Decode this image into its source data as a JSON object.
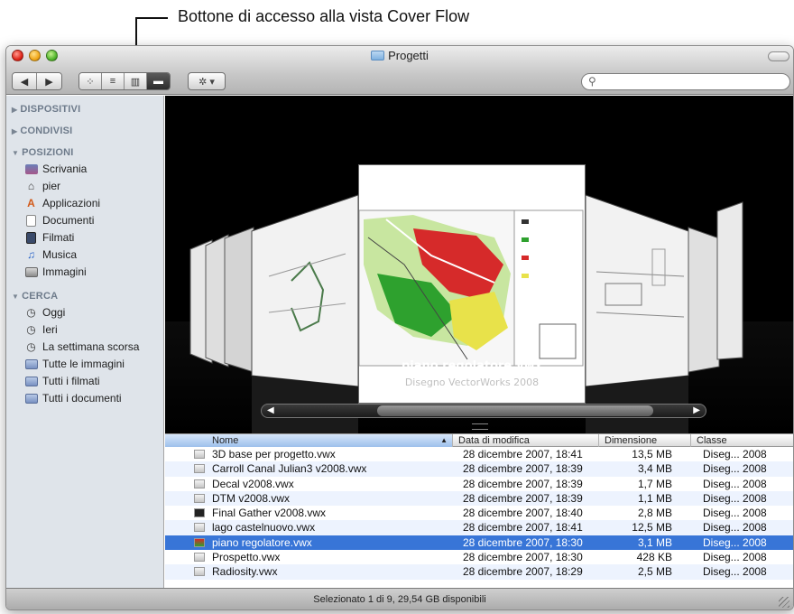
{
  "callout": {
    "text": "Bottone di accesso alla vista Cover Flow"
  },
  "window": {
    "title": "Progetti"
  },
  "toolbar": {
    "back": "◀",
    "forward": "▶",
    "view_icon": "⁘",
    "view_list": "≡",
    "view_columns": "▥",
    "view_coverflow": "▬",
    "action": "✲ ▾",
    "search_icon": "⚲",
    "search_placeholder": ""
  },
  "sidebar": {
    "sections": {
      "devices": "DISPOSITIVI",
      "shared": "CONDIVISI",
      "places": "POSIZIONI",
      "search": "CERCA"
    },
    "places": [
      {
        "label": "Scrivania",
        "icon": "desktop-icon"
      },
      {
        "label": "pier",
        "icon": "home-icon"
      },
      {
        "label": "Applicazioni",
        "icon": "applications-icon"
      },
      {
        "label": "Documenti",
        "icon": "documents-icon"
      },
      {
        "label": "Filmati",
        "icon": "movies-icon"
      },
      {
        "label": "Musica",
        "icon": "music-icon"
      },
      {
        "label": "Immagini",
        "icon": "pictures-icon"
      }
    ],
    "search_items": [
      {
        "label": "Oggi",
        "icon": "clock-icon"
      },
      {
        "label": "Ieri",
        "icon": "clock-icon"
      },
      {
        "label": "La settimana scorsa",
        "icon": "clock-icon"
      },
      {
        "label": "Tutte le immagini",
        "icon": "smart-folder-icon"
      },
      {
        "label": "Tutti i filmati",
        "icon": "smart-folder-icon"
      },
      {
        "label": "Tutti i documenti",
        "icon": "smart-folder-icon"
      }
    ]
  },
  "coverflow": {
    "selected_name": "piano regolatore.vwx",
    "selected_kind": "Disegno VectorWorks 2008"
  },
  "list": {
    "columns": {
      "name": "Nome",
      "date": "Data di modifica",
      "size": "Dimensione",
      "kind": "Classe"
    },
    "rows": [
      {
        "name": "3D base per progetto.vwx",
        "date": "28 dicembre 2007, 18:41",
        "size": "13,5 MB",
        "kind": "Diseg... 2008"
      },
      {
        "name": "Carroll Canal Julian3 v2008.vwx",
        "date": "28 dicembre 2007, 18:39",
        "size": "3,4 MB",
        "kind": "Diseg... 2008"
      },
      {
        "name": "Decal v2008.vwx",
        "date": "28 dicembre 2007, 18:39",
        "size": "1,7 MB",
        "kind": "Diseg... 2008"
      },
      {
        "name": "DTM v2008.vwx",
        "date": "28 dicembre 2007, 18:39",
        "size": "1,1 MB",
        "kind": "Diseg... 2008"
      },
      {
        "name": "Final Gather v2008.vwx",
        "date": "28 dicembre 2007, 18:40",
        "size": "2,8 MB",
        "kind": "Diseg... 2008"
      },
      {
        "name": "lago castelnuovo.vwx",
        "date": "28 dicembre 2007, 18:41",
        "size": "12,5 MB",
        "kind": "Diseg... 2008"
      },
      {
        "name": "piano regolatore.vwx",
        "date": "28 dicembre 2007, 18:30",
        "size": "3,1 MB",
        "kind": "Diseg... 2008"
      },
      {
        "name": "Prospetto.vwx",
        "date": "28 dicembre 2007, 18:30",
        "size": "428 KB",
        "kind": "Diseg... 2008"
      },
      {
        "name": "Radiosity.vwx",
        "date": "28 dicembre 2007, 18:29",
        "size": "2,5 MB",
        "kind": "Diseg... 2008"
      }
    ],
    "selected_index": 6
  },
  "status": {
    "text": "Selezionato 1 di 9, 29,54 GB disponibili"
  },
  "colors": {
    "selection": "#3875d7",
    "sidebar_bg": "#dfe4ea",
    "coverflow_bg": "#000000"
  }
}
